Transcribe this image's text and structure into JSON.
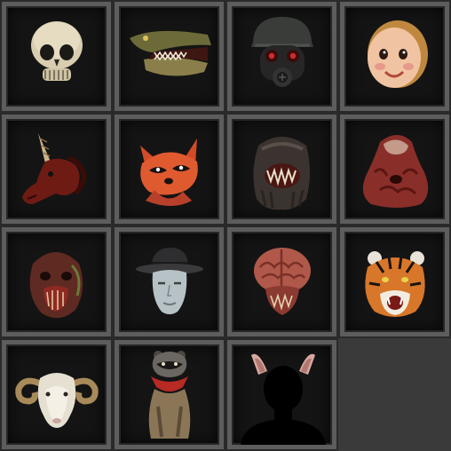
{
  "masks": [
    {
      "icon": "skull-mask-icon"
    },
    {
      "icon": "crocodile-mask-icon"
    },
    {
      "icon": "gas-mask-helmet-icon"
    },
    {
      "icon": "doll-face-mask-icon"
    },
    {
      "icon": "unicorn-mask-icon"
    },
    {
      "icon": "cartoon-fox-mask-icon"
    },
    {
      "icon": "fanged-monster-mask-icon"
    },
    {
      "icon": "flesh-blob-mask-icon"
    },
    {
      "icon": "rotten-zombie-mask-icon"
    },
    {
      "icon": "fedora-man-mask-icon"
    },
    {
      "icon": "exposed-brain-mask-icon"
    },
    {
      "icon": "tiger-mask-icon"
    },
    {
      "icon": "ram-mask-icon"
    },
    {
      "icon": "raccoon-scarf-mask-icon"
    },
    {
      "icon": "cat-ears-silhouette-icon"
    }
  ],
  "colors": {
    "background": "#3a3a3a",
    "slot_fill": "#141414",
    "slot_frame": "#5d5d5d"
  }
}
